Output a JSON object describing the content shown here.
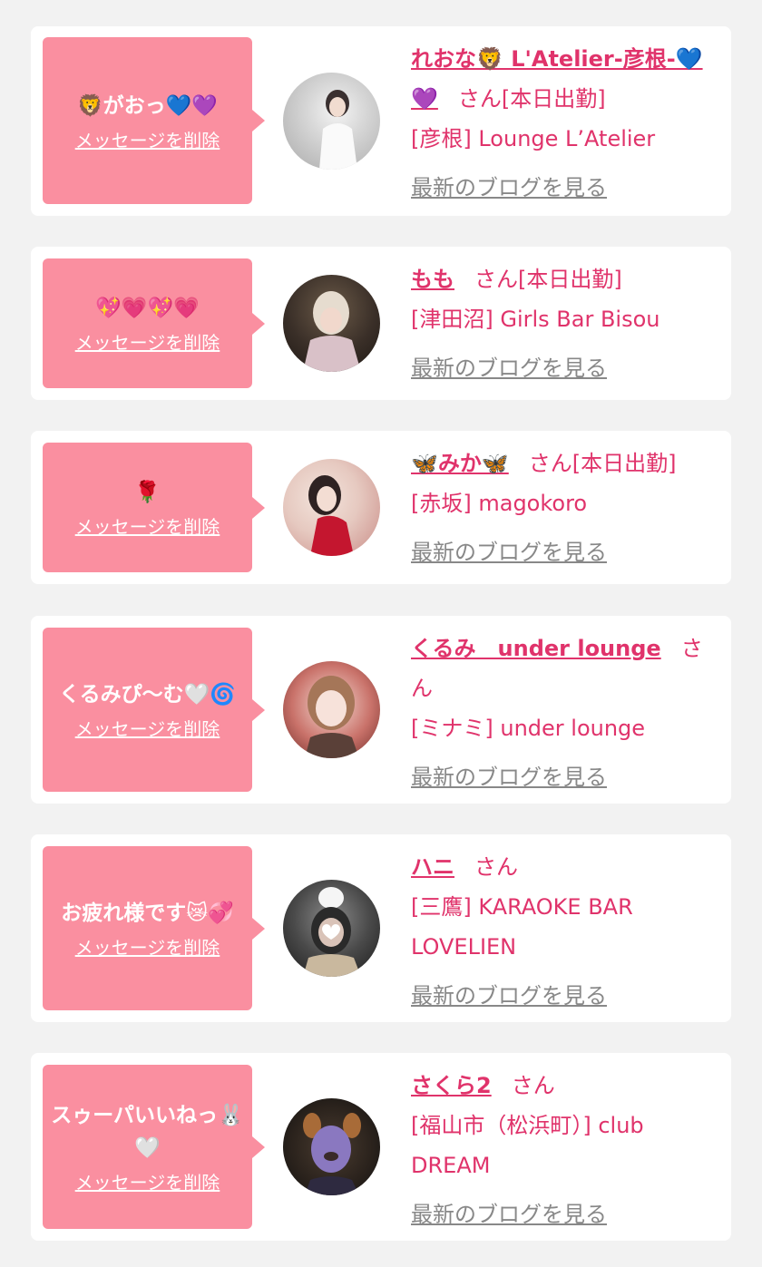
{
  "colors": {
    "accent": "#e0336b",
    "bubble": "#fa8fa0",
    "background": "#f2f2f2",
    "muted": "#888888"
  },
  "entries": [
    {
      "message": "🦁がおっ💙💜",
      "delete_label": "メッセージを削除",
      "name": "れおな🦁 L'Atelier-彦根-💙💜",
      "honorific": "さん",
      "status": "[本日出勤]",
      "shop": "[彦根] Lounge L’Atelier",
      "blog_label": "最新のブログを見る",
      "avatar_icon": "avatar-photo"
    },
    {
      "message": "💖💗💖💗",
      "delete_label": "メッセージを削除",
      "name": "もも",
      "honorific": "さん",
      "status": "[本日出勤]",
      "shop": "[津田沼] Girls Bar Bisou",
      "blog_label": "最新のブログを見る",
      "avatar_icon": "avatar-photo"
    },
    {
      "message": "🌹",
      "delete_label": "メッセージを削除",
      "name": "🦋みか🦋",
      "honorific": "さん",
      "status": "[本日出勤]",
      "shop": "[赤坂] magokoro",
      "blog_label": "最新のブログを見る",
      "avatar_icon": "avatar-photo"
    },
    {
      "message": "くるみぴ〜む🤍🌀",
      "delete_label": "メッセージを削除",
      "name": "くるみ　under lounge",
      "honorific": "さん",
      "status": "",
      "shop": "[ミナミ] under lounge",
      "blog_label": "最新のブログを見る",
      "avatar_icon": "avatar-photo"
    },
    {
      "message": "お疲れ様です😿💞",
      "delete_label": "メッセージを削除",
      "name": "ハニ",
      "honorific": "さん",
      "status": "",
      "shop": "[三鷹] KARAOKE BAR LOVELIEN",
      "blog_label": "最新のブログを見る",
      "avatar_icon": "avatar-photo"
    },
    {
      "message": "スゥーパいいねっ🐰🤍",
      "delete_label": "メッセージを削除",
      "name": "さくら2",
      "honorific": "さん",
      "status": "",
      "shop": "[福山市（松浜町）] club DREAM",
      "blog_label": "最新のブログを見る",
      "avatar_icon": "avatar-photo"
    }
  ]
}
